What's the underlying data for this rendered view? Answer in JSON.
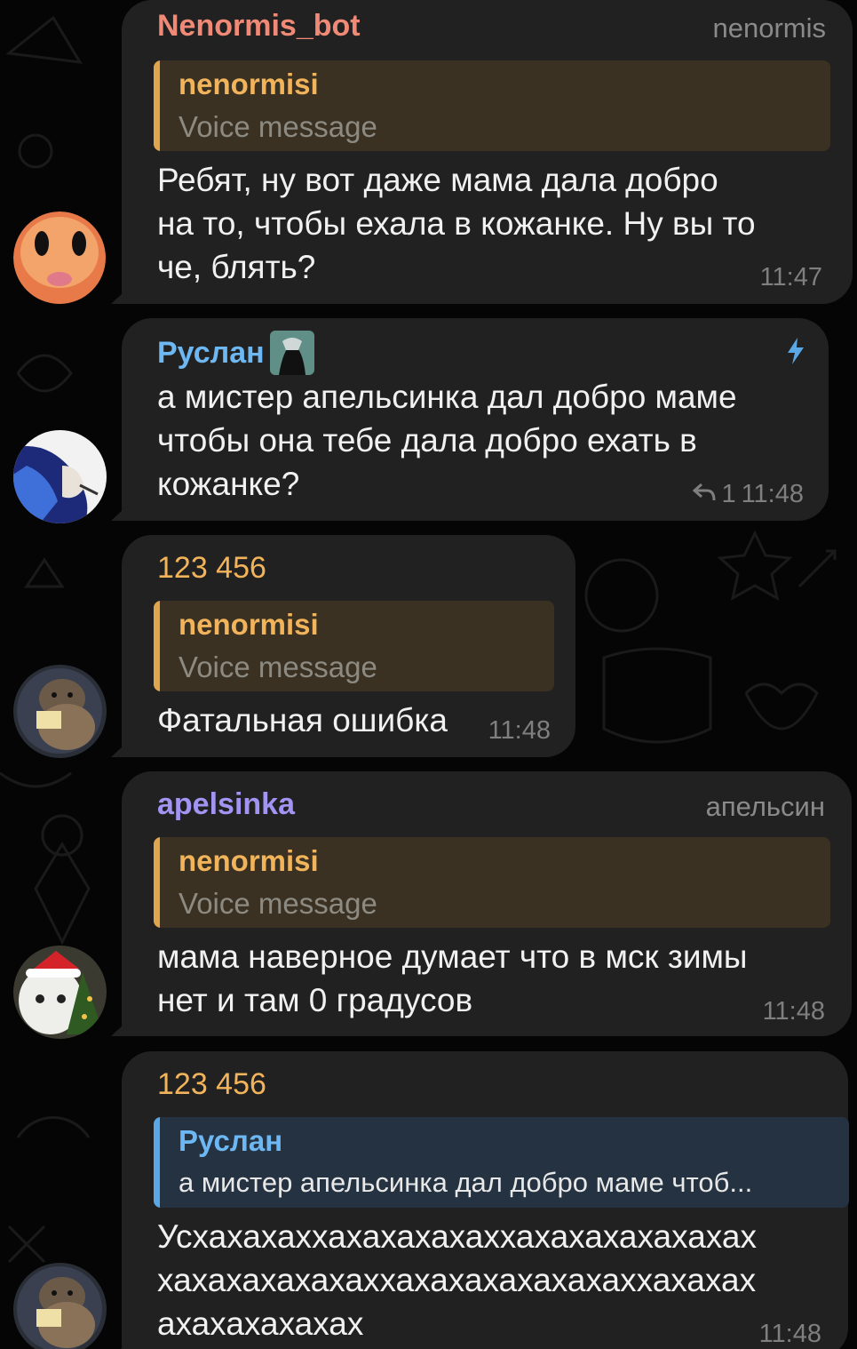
{
  "colors": {
    "background": "#050505",
    "bubble": "#212121",
    "name_bot": "#f08a76",
    "name_ruslan": "#6db7f2",
    "name_orange": "#f2b45a",
    "name_purple": "#a294f2",
    "timestamp": "#7f7f7f"
  },
  "messages": [
    {
      "sender": "Nenormis_bot",
      "role": "nenormis",
      "reply": {
        "name": "nenormisi",
        "text": "Voice message"
      },
      "lines": [
        "Ребят, ну вот даже мама дала добро",
        "на то, чтобы ехала в кожанке. Ну вы то",
        "че, блять?"
      ],
      "time": "11:47",
      "avatar_icon": "cartoon-face-avatar"
    },
    {
      "sender": "Руслан",
      "badge_icon": "anime-sticker-badge",
      "boost_icon": "lightning-bolt-icon",
      "lines": [
        "а мистер апельсинка дал добро маме",
        "чтобы она тебе дала добро ехать в",
        "кожанке?"
      ],
      "reply_count": "1",
      "reply_icon": "reply-arrow-icon",
      "time": "11:48",
      "avatar_icon": "anime-character-avatar"
    },
    {
      "sender": "123 456",
      "reply": {
        "name": "nenormisi",
        "text": "Voice message"
      },
      "lines": [
        "Фатальная ошибка"
      ],
      "time": "11:48",
      "avatar_icon": "otter-avatar"
    },
    {
      "sender": "apelsinka",
      "role": "апельсин",
      "reply": {
        "name": "nenormisi",
        "text": "Voice message"
      },
      "lines": [
        "мама наверное думает что в мск зимы",
        "нет и там 0 градусов"
      ],
      "time": "11:48",
      "avatar_icon": "cat-santa-hat-avatar"
    },
    {
      "sender": "123 456",
      "reply": {
        "name": "Руслан",
        "text": "а мистер апельсинка дал добро маме чтоб..."
      },
      "lines": [
        "Усхахахаххахахахахаххахахахахахахах",
        "хахахахахахаххахахахахахахаххахахах",
        "ахахахахахах"
      ],
      "time": "11:48",
      "avatar_icon": "otter-avatar"
    }
  ]
}
